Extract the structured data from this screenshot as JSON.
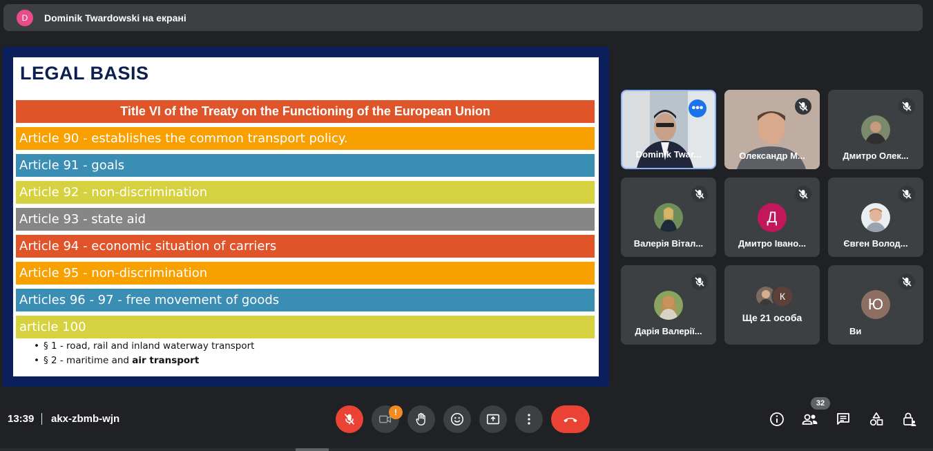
{
  "presenter_bar": {
    "avatar_letter": "D",
    "text": "Dominik Twardowski на екрані"
  },
  "slide": {
    "title": "LEGAL BASIS",
    "header": "Title VI of the Treaty on the Functioning of the European Union",
    "rows": [
      "Article 90 - establishes the common transport policy.",
      "Article 91 - goals",
      "Article 92 - non-discrimination",
      "Article 93 - state aid",
      "Article 94 - economic situation of carriers",
      "Article 95 - non-discrimination",
      "Articles 96 - 97 - free movement of goods",
      "article 100"
    ],
    "row_colors": [
      "#f7a000",
      "#3a8db3",
      "#d6d13f",
      "#868686",
      "#e0542a",
      "#f7a000",
      "#3a8db3",
      "#d6d13f"
    ],
    "header_color": "#e0542a",
    "bullet1": "§ 1 - road, rail and inland waterway transport",
    "bullet2_prefix": "§ 2 - maritime and ",
    "bullet2_bold": "air transport"
  },
  "participants": [
    {
      "name": "Dominik Twar...",
      "type": "video"
    },
    {
      "name": "Олександр М...",
      "type": "video"
    },
    {
      "name": "Дмитро Олек...",
      "type": "photo"
    },
    {
      "name": "Валерія Вітал...",
      "type": "photo"
    },
    {
      "name": "Дмитро Івано...",
      "type": "letter",
      "letter": "Д",
      "color": "#c2185b"
    },
    {
      "name": "Євген Волод...",
      "type": "photo"
    },
    {
      "name": "Дарія Валерії...",
      "type": "photo"
    },
    {
      "name": "Ще 21 особа",
      "type": "more",
      "letter": "К"
    },
    {
      "name": "Ви",
      "type": "letter",
      "letter": "Ю",
      "color": "#8d6e63"
    }
  ],
  "toolbar": {
    "time": "13:39",
    "meeting_code": "akx-zbmb-wjn",
    "warn_badge": "!",
    "people_count": "32"
  },
  "colors": {
    "accent": "#1a73e8",
    "danger": "#ea4335",
    "surface": "#3c4043",
    "background": "#202124"
  }
}
